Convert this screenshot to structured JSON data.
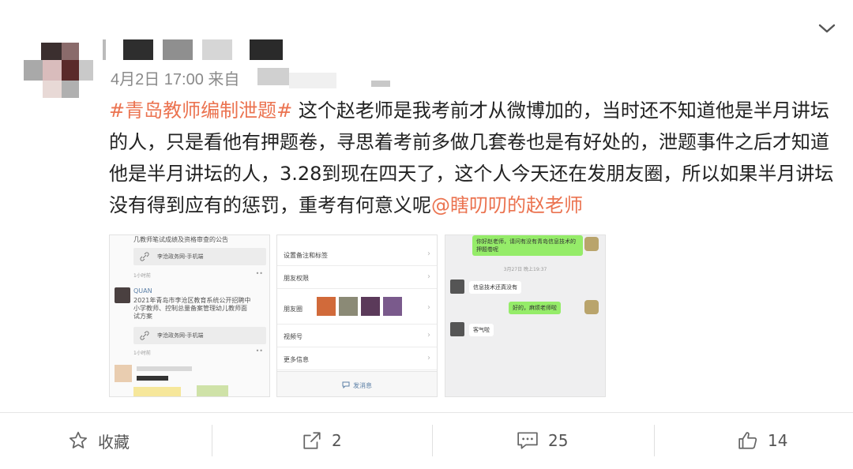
{
  "post": {
    "meta": "4月2日 17:00 来自",
    "hashtag": "#青岛教师编制泄题#",
    "text": " 这个赵老师是我考前才从微博加的，当时还不知道他是半月讲坛的人，只是看他有押题卷，寻思着考前多做几套卷也是有好处的，泄题事件之后才知道他是半月讲坛的人，3.28到现在四天了，这个人今天还在发朋友圈，所以如果半月讲坛没有得到应有的惩罚，重考有何意义呢",
    "mention": "@瞎叨叨的赵老师"
  },
  "images": {
    "img1": {
      "header": "几教师笔试成绩及资格审查的公告",
      "link1": "李沧政务网-手机端",
      "time1": "1小时前",
      "username": "QUAN",
      "post": [
        "2021年青岛市李沧区教育系统公开招聘中",
        "小学教师、控制总量备案管理幼儿教师面",
        "试方案"
      ],
      "link2": "李沧政务网-手机端",
      "time2": "1小时前"
    },
    "img2": {
      "items": [
        "设置备注和标签",
        "朋友权限",
        "朋友圈",
        "视频号",
        "更多信息"
      ],
      "send": "发消息"
    },
    "img3": {
      "msg1": "你好赵老师，请问有没有青岛信息技术的押题卷呢",
      "timestamp": "3月27日 晚上19:37",
      "msg2": "信息技术还真没有",
      "msg3": "好的，麻烦老师啦",
      "msg4": "客气啦"
    }
  },
  "footer": {
    "favorite": "收藏",
    "repost": "2",
    "comment": "25",
    "like": "14"
  },
  "colors": {
    "accent": "#eb7350",
    "text": "#222222",
    "muted": "#8a8a8a"
  },
  "icons": [
    "chevron-down-icon",
    "star-icon",
    "repost-icon",
    "comment-icon",
    "thumbs-up-icon",
    "link-icon",
    "chat-icon"
  ]
}
